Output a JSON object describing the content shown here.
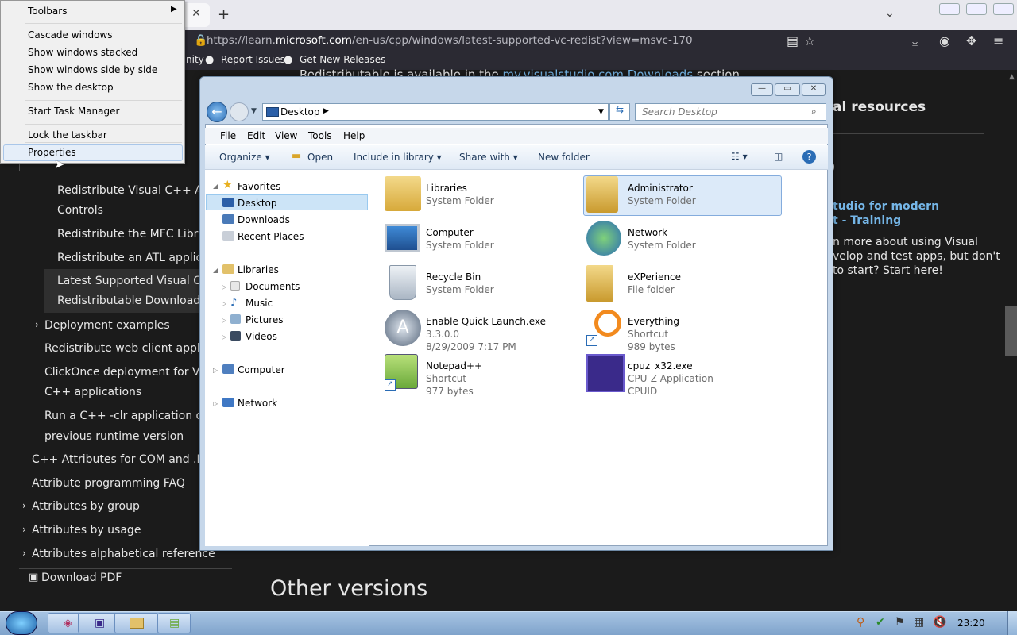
{
  "browser": {
    "url_prefix": "https://learn.",
    "url_domain": "microsoft.com",
    "url_path": "/en-us/cpp/windows/latest-supported-vc-redist?view=msvc-170",
    "bookmarks": [
      "nity",
      "Report Issues",
      "Get New Releases"
    ]
  },
  "page": {
    "top_text": "Redistributable is available in the ",
    "top_link": "my.visualstudio.com Downloads",
    "top_text_end": " section.",
    "right_heading": "al resources",
    "right_link_1": "tudio for modern",
    "right_link_2a": "t - ",
    "right_link_2b": "Training",
    "right_para": [
      "n more about using Visual",
      "velop and test apps, but don't",
      "to start? Start here!"
    ],
    "other_versions": "Other versions",
    "download_pdf": "Download PDF",
    "sidebar": [
      "Redistribute Visual C++ Activ",
      "Controls",
      "Redistribute the MFC Library",
      "Redistribute an ATL applicatio",
      "Latest Supported Visual C++",
      "Redistributable Downloads",
      "Deployment examples",
      "Redistribute web client applicatio",
      "ClickOnce deployment for Visua",
      "C++ applications",
      "Run a C++ -clr application on a",
      "previous runtime version",
      "C++ Attributes for COM and .NET",
      "Attribute programming FAQ",
      "Attributes by group",
      "Attributes by usage",
      "Attributes alphabetical reference"
    ]
  },
  "context_menu": {
    "items": [
      "Toolbars",
      "Cascade windows",
      "Show windows stacked",
      "Show windows side by side",
      "Show the desktop",
      "Start Task Manager",
      "Lock the taskbar",
      "Properties"
    ]
  },
  "explorer": {
    "address": "Desktop",
    "search_placeholder": "Search Desktop",
    "menu": [
      "File",
      "Edit",
      "View",
      "Tools",
      "Help"
    ],
    "commands": [
      "Organize",
      "Open",
      "Include in library",
      "Share with",
      "New folder"
    ],
    "nav": {
      "favorites": "Favorites",
      "desktop": "Desktop",
      "downloads": "Downloads",
      "recent": "Recent Places",
      "libraries": "Libraries",
      "documents": "Documents",
      "music": "Music",
      "pictures": "Pictures",
      "videos": "Videos",
      "computer": "Computer",
      "network": "Network"
    },
    "items": [
      {
        "name": "Libraries",
        "l1": "System Folder",
        "l2": ""
      },
      {
        "name": "Administrator",
        "l1": "System Folder",
        "l2": ""
      },
      {
        "name": "Computer",
        "l1": "System Folder",
        "l2": ""
      },
      {
        "name": "Network",
        "l1": "System Folder",
        "l2": ""
      },
      {
        "name": "Recycle Bin",
        "l1": "System Folder",
        "l2": ""
      },
      {
        "name": "eXPerience",
        "l1": "File folder",
        "l2": ""
      },
      {
        "name": "Enable Quick Launch.exe",
        "l1": "3.3.0.0",
        "l2": "8/29/2009 7:17 PM"
      },
      {
        "name": "Everything",
        "l1": "Shortcut",
        "l2": "989 bytes"
      },
      {
        "name": "Notepad++",
        "l1": "Shortcut",
        "l2": "977 bytes"
      },
      {
        "name": "cpuz_x32.exe",
        "l1": "CPU-Z Application",
        "l2": "CPUID"
      }
    ]
  },
  "taskbar": {
    "clock": "23:20"
  }
}
